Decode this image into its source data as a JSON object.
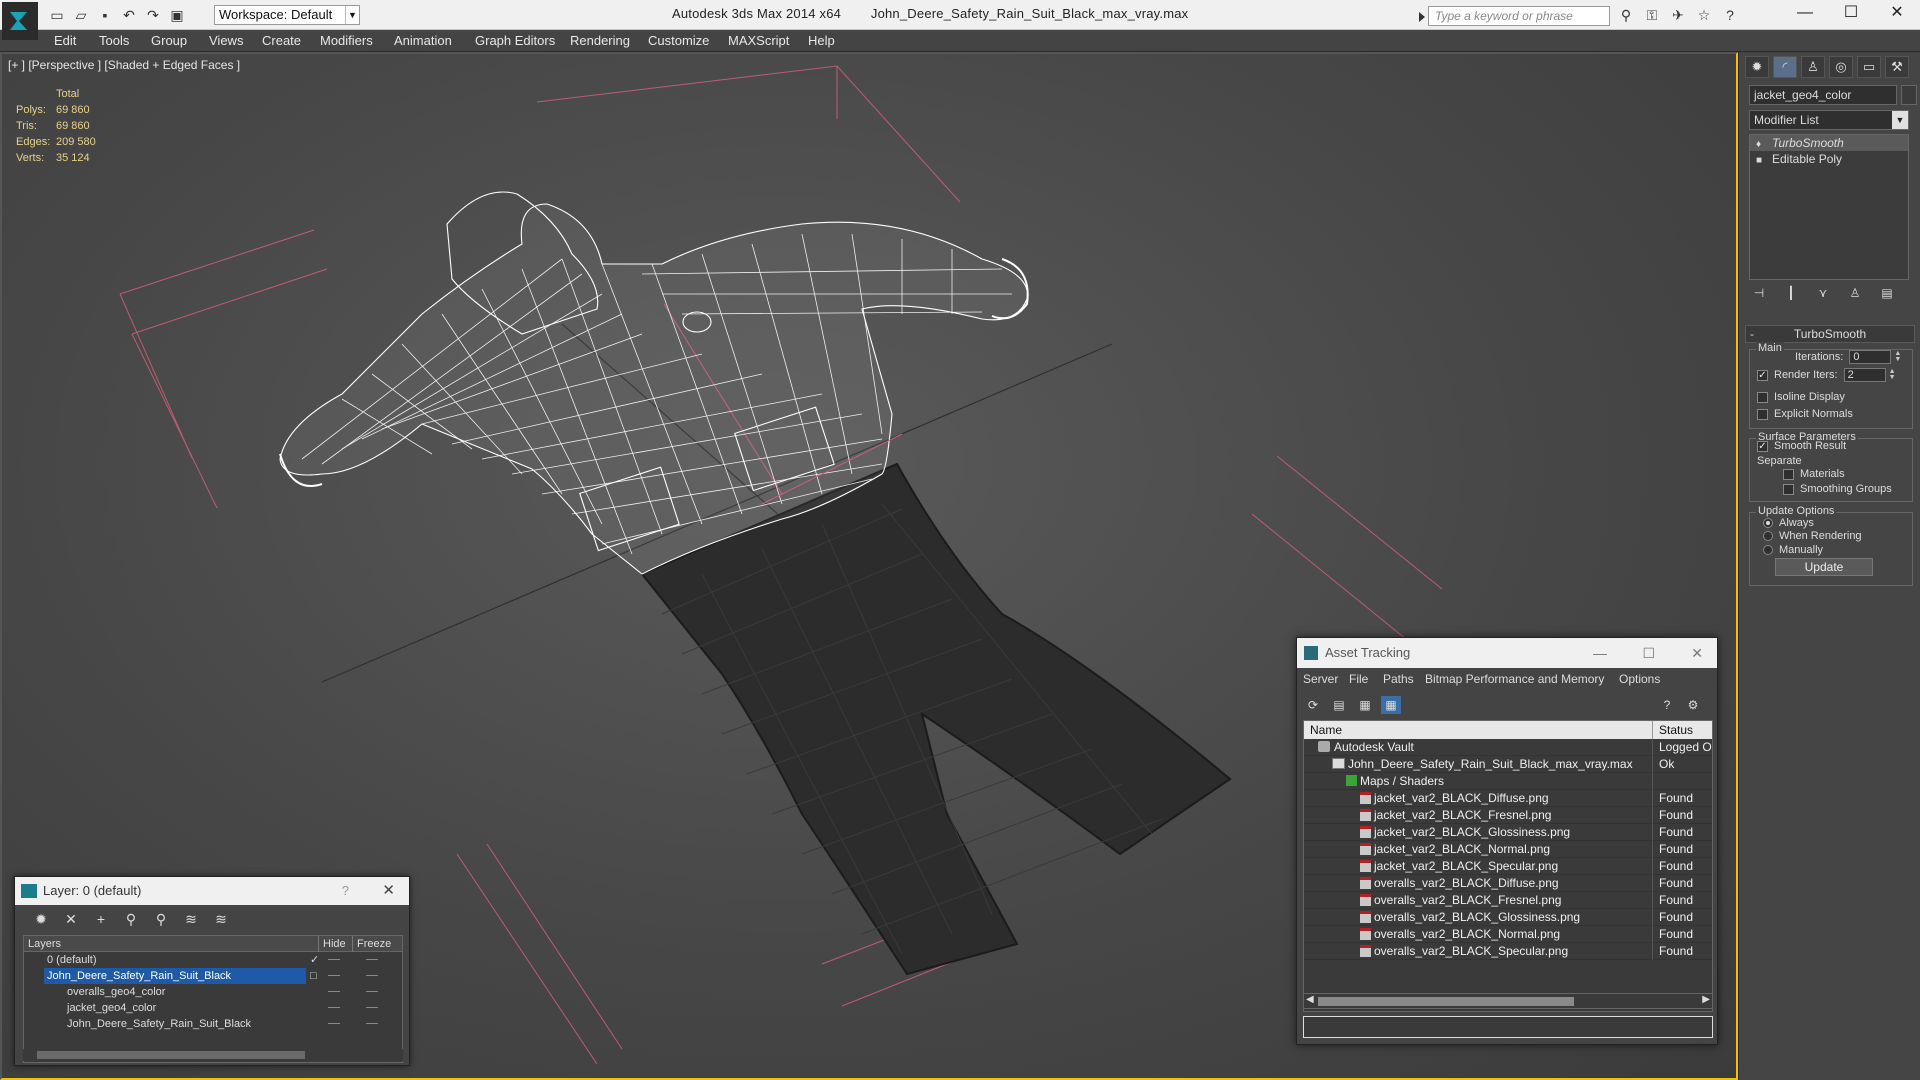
{
  "titlebar": {
    "workspace": "Workspace: Default",
    "app_name": "Autodesk 3ds Max  2014 x64",
    "file_name": "John_Deere_Safety_Rain_Suit_Black_max_vray.max",
    "search_placeholder": "Type a keyword or phrase"
  },
  "menu": [
    "Edit",
    "Tools",
    "Group",
    "Views",
    "Create",
    "Modifiers",
    "Animation",
    "Graph Editors",
    "Rendering",
    "Customize",
    "MAXScript",
    "Help"
  ],
  "viewport": {
    "label": "[+ ] [Perspective ] [Shaded + Edged Faces ]",
    "stats_header": "Total",
    "stats": [
      {
        "key": "Polys:",
        "value": "69 860"
      },
      {
        "key": "Tris:",
        "value": "69 860"
      },
      {
        "key": "Edges:",
        "value": "209 580"
      },
      {
        "key": "Verts:",
        "value": "35 124"
      }
    ]
  },
  "command_panel": {
    "object_name": "jacket_geo4_color",
    "modifier_list": "Modifier List",
    "stack": [
      "TurboSmooth",
      "Editable Poly"
    ],
    "rollout_title": "TurboSmooth",
    "main_group": "Main",
    "iterations_label": "Iterations:",
    "iterations_value": "0",
    "render_iters_label": "Render Iters:",
    "render_iters_value": "2",
    "isoline": "Isoline Display",
    "explicit_normals": "Explicit Normals",
    "surface_group": "Surface Parameters",
    "smooth_result": "Smooth Result",
    "separate": "Separate",
    "materials": "Materials",
    "smoothing_groups": "Smoothing Groups",
    "update_group": "Update Options",
    "always": "Always",
    "when_rendering": "When Rendering",
    "manually": "Manually",
    "update_button": "Update"
  },
  "layer_dialog": {
    "title": "Layer: 0 (default)",
    "help": "?",
    "col_layers": "Layers",
    "col_hide": "Hide",
    "col_freeze": "Freeze",
    "rows": [
      {
        "name": "0 (default)"
      },
      {
        "name": "John_Deere_Safety_Rain_Suit_Black"
      },
      {
        "name": "overalls_geo4_color"
      },
      {
        "name": "jacket_geo4_color"
      },
      {
        "name": "John_Deere_Safety_Rain_Suit_Black"
      }
    ]
  },
  "asset_tracking": {
    "title": "Asset Tracking",
    "menu": [
      "Server",
      "File",
      "Paths",
      "Bitmap Performance and Memory",
      "Options"
    ],
    "col_name": "Name",
    "col_status": "Status",
    "rows": [
      {
        "name": "Autodesk Vault",
        "status": "Logged Out"
      },
      {
        "name": "John_Deere_Safety_Rain_Suit_Black_max_vray.max",
        "status": "Ok"
      },
      {
        "name": "Maps / Shaders",
        "status": ""
      },
      {
        "name": "jacket_var2_BLACK_Diffuse.png",
        "status": "Found"
      },
      {
        "name": "jacket_var2_BLACK_Fresnel.png",
        "status": "Found"
      },
      {
        "name": "jacket_var2_BLACK_Glossiness.png",
        "status": "Found"
      },
      {
        "name": "jacket_var2_BLACK_Normal.png",
        "status": "Found"
      },
      {
        "name": "jacket_var2_BLACK_Specular.png",
        "status": "Found"
      },
      {
        "name": "overalls_var2_BLACK_Diffuse.png",
        "status": "Found"
      },
      {
        "name": "overalls_var2_BLACK_Fresnel.png",
        "status": "Found"
      },
      {
        "name": "overalls_var2_BLACK_Glossiness.png",
        "status": "Found"
      },
      {
        "name": "overalls_var2_BLACK_Normal.png",
        "status": "Found"
      },
      {
        "name": "overalls_var2_BLACK_Specular.png",
        "status": "Found"
      }
    ]
  }
}
